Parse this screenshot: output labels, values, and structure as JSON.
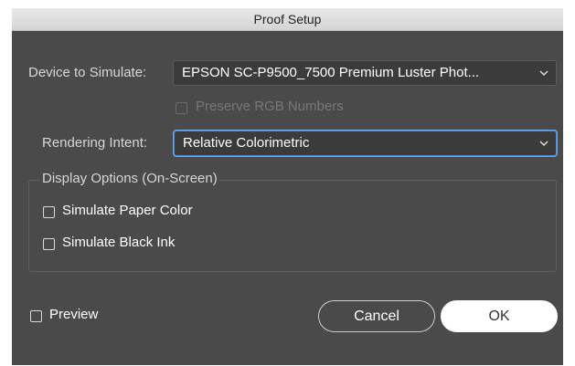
{
  "window": {
    "title": "Proof Setup"
  },
  "device": {
    "label": "Device to Simulate:",
    "value": "EPSON SC-P9500_7500 Premium Luster Phot..."
  },
  "preserve_rgb": {
    "label": "Preserve RGB Numbers",
    "checked": false,
    "enabled": false
  },
  "rendering": {
    "label": "Rendering Intent:",
    "value": "Relative Colorimetric"
  },
  "display_options": {
    "title": "Display Options (On-Screen)",
    "simulate_paper": {
      "label": "Simulate Paper Color",
      "checked": false
    },
    "simulate_black": {
      "label": "Simulate Black Ink",
      "checked": false
    }
  },
  "preview": {
    "label": "Preview",
    "checked": false
  },
  "buttons": {
    "cancel": "Cancel",
    "ok": "OK"
  },
  "colors": {
    "dialog_bg": "#4a4a4a",
    "focus_ring": "#4a90d9",
    "default_button": "#ffffff"
  }
}
